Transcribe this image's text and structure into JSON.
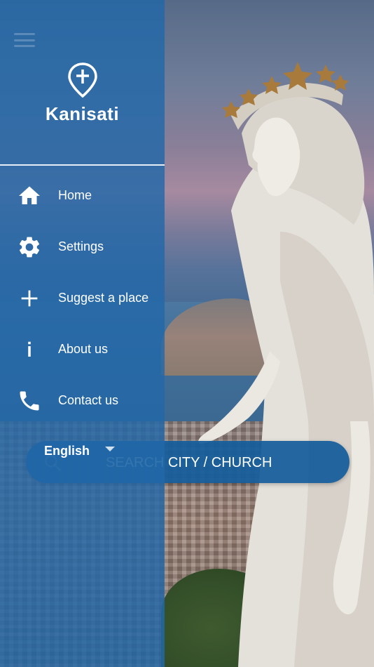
{
  "app": {
    "logo_text": "Kanisati"
  },
  "menu": {
    "items": [
      {
        "label": "Home",
        "icon": "home-icon"
      },
      {
        "label": "Settings",
        "icon": "gear-icon"
      },
      {
        "label": "Suggest a place",
        "icon": "plus-icon"
      },
      {
        "label": "About us",
        "icon": "info-icon"
      },
      {
        "label": "Contact us",
        "icon": "phone-icon"
      }
    ]
  },
  "language": {
    "selected": "English"
  },
  "search": {
    "placeholder": "SEARCH CITY / CHURCH",
    "value": ""
  },
  "colors": {
    "drawer": "#2268a8",
    "search_bar": "#145c9b",
    "text": "#ffffff"
  }
}
